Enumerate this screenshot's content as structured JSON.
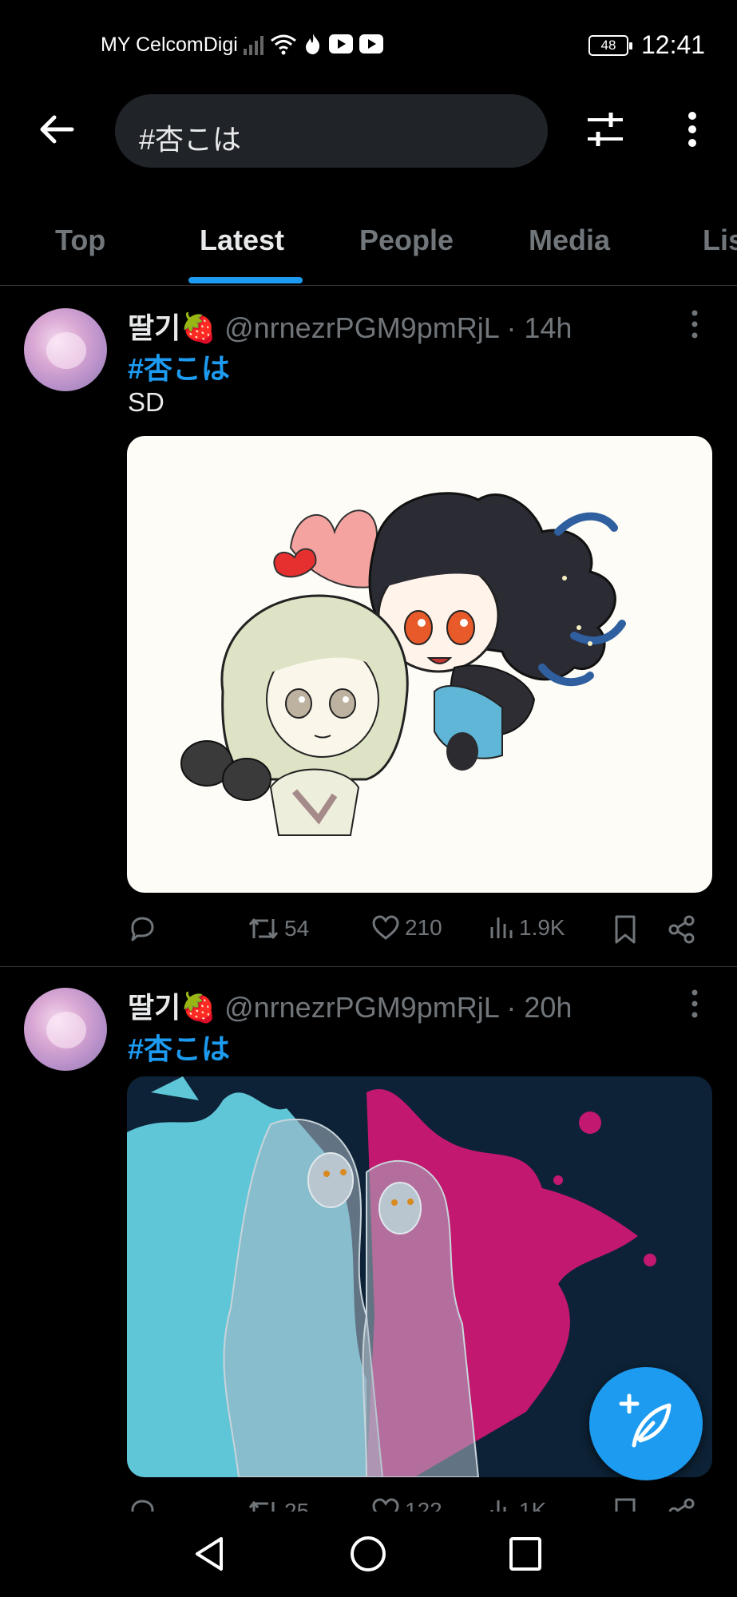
{
  "status_bar": {
    "carrier": "MY CelcomDigi",
    "battery": "48",
    "time": "12:41"
  },
  "header": {
    "search_query": "#杏こは"
  },
  "tabs": [
    {
      "label": "Top"
    },
    {
      "label": "Latest"
    },
    {
      "label": "People"
    },
    {
      "label": "Media"
    },
    {
      "label": "Lis"
    }
  ],
  "active_tab": "Latest",
  "tweets": [
    {
      "display_name": "딸기🍓",
      "handle": "@nrnezrPGM9pmRjL · 14h",
      "hashtag": "#杏こは",
      "text": "SD",
      "media_description_icon": "illustration",
      "stats": {
        "replies": "",
        "retweets": "54",
        "likes": "210",
        "views": "1.9K"
      }
    },
    {
      "display_name": "딸기🍓",
      "handle": "@nrnezrPGM9pmRjL · 20h",
      "hashtag": "#杏こは",
      "text": "",
      "media_description_icon": "illustration",
      "stats": {
        "replies": "",
        "retweets": "25",
        "likes": "122",
        "views": "1K"
      }
    }
  ],
  "colors": {
    "accent": "#1d9bf0",
    "background": "#000000",
    "muted": "#71767b",
    "separator": "#2f3336"
  }
}
